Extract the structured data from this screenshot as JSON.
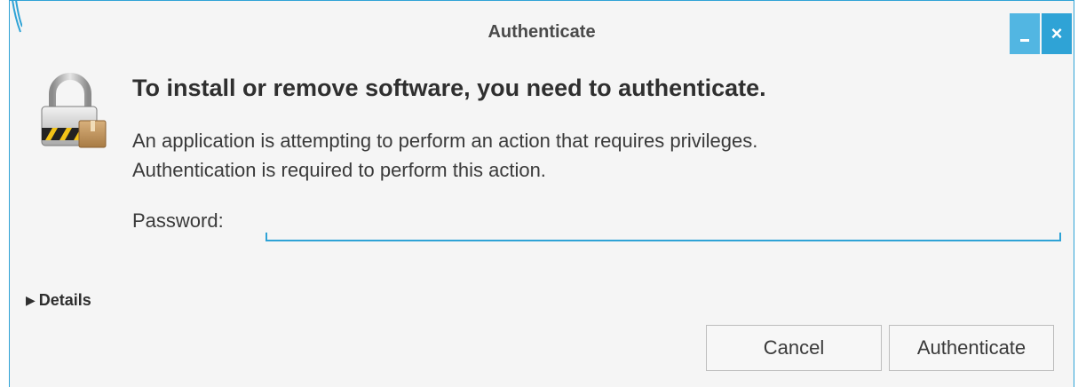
{
  "window": {
    "title": "Authenticate",
    "close_glyph": "×"
  },
  "dialog": {
    "heading": "To install or remove software, you need to authenticate.",
    "description_line1": "An application is attempting to perform an action that requires privileges.",
    "description_line2": "Authentication is required to perform this action.",
    "password_label": "Password:",
    "password_value": "",
    "details_label": "Details",
    "details_glyph": "▶"
  },
  "buttons": {
    "cancel": "Cancel",
    "authenticate": "Authenticate"
  },
  "icons": {
    "lock": "lock-icon",
    "minimize": "minimize-icon",
    "close": "close-icon",
    "expander": "triangle-right-icon"
  },
  "colors": {
    "accent": "#2fa3d6",
    "background": "#f5f5f5"
  }
}
